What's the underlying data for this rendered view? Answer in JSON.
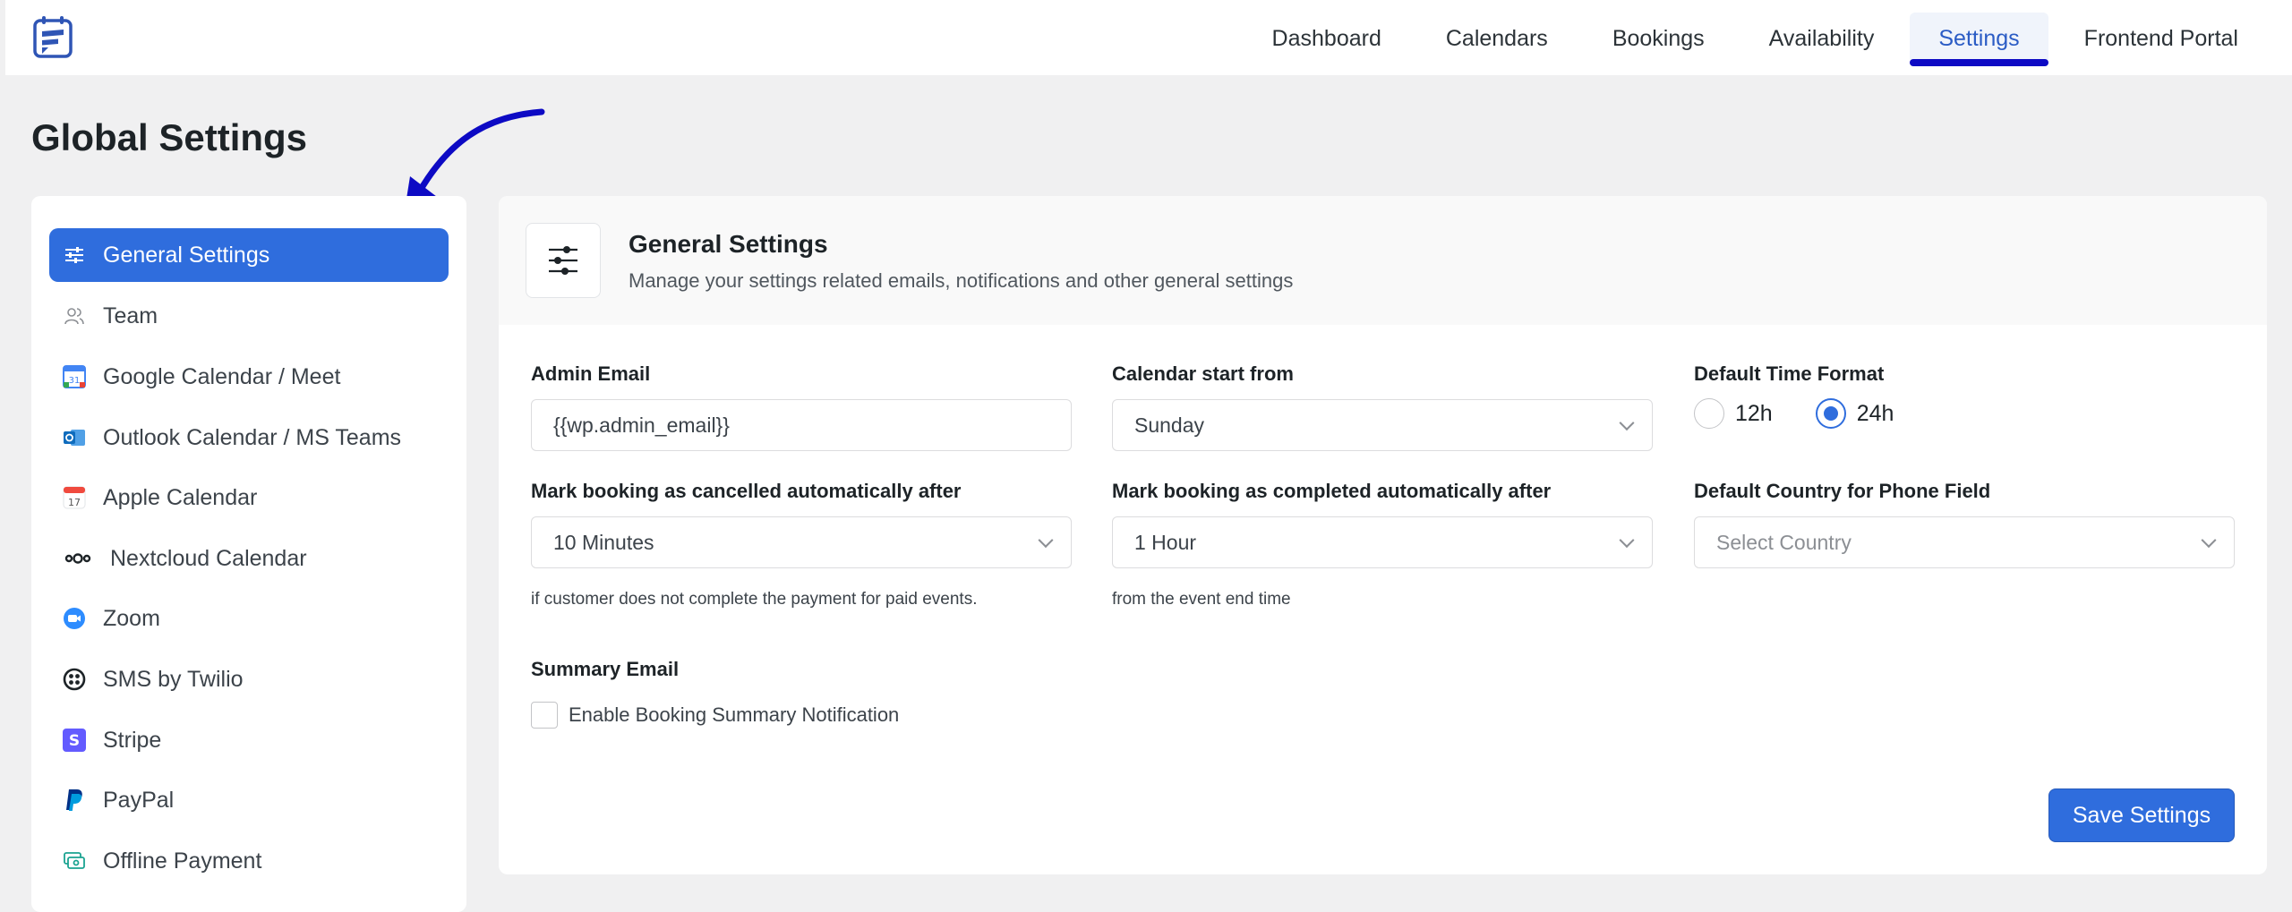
{
  "nav": {
    "items": [
      {
        "label": "Dashboard"
      },
      {
        "label": "Calendars"
      },
      {
        "label": "Bookings"
      },
      {
        "label": "Availability"
      },
      {
        "label": "Settings",
        "active": true
      },
      {
        "label": "Frontend Portal"
      }
    ]
  },
  "page": {
    "title": "Global Settings"
  },
  "sidebar": {
    "items": [
      {
        "label": "General Settings",
        "icon": "sliders-icon",
        "active": true
      },
      {
        "label": "Team",
        "icon": "team-icon"
      },
      {
        "label": "Google Calendar / Meet",
        "icon": "google-calendar-icon"
      },
      {
        "label": "Outlook Calendar / MS Teams",
        "icon": "outlook-icon"
      },
      {
        "label": "Apple Calendar",
        "icon": "apple-calendar-icon"
      },
      {
        "label": "Nextcloud Calendar",
        "icon": "nextcloud-icon"
      },
      {
        "label": "Zoom",
        "icon": "zoom-icon"
      },
      {
        "label": "SMS by Twilio",
        "icon": "twilio-icon"
      },
      {
        "label": "Stripe",
        "icon": "stripe-icon"
      },
      {
        "label": "PayPal",
        "icon": "paypal-icon"
      },
      {
        "label": "Offline Payment",
        "icon": "offline-payment-icon"
      }
    ]
  },
  "panel": {
    "title": "General Settings",
    "subtitle": "Manage your settings related emails, notifications and other general settings",
    "admin_email": {
      "label": "Admin Email",
      "value": "{{wp.admin_email}}"
    },
    "calendar_start": {
      "label": "Calendar start from",
      "value": "Sunday"
    },
    "time_format": {
      "label": "Default Time Format",
      "options": [
        "12h",
        "24h"
      ],
      "selected": "24h"
    },
    "cancel_after": {
      "label": "Mark booking as cancelled automatically after",
      "value": "10 Minutes",
      "hint": "if customer does not complete the payment for paid events."
    },
    "complete_after": {
      "label": "Mark booking as completed automatically after",
      "value": "1 Hour",
      "hint": "from the event end time"
    },
    "phone_country": {
      "label": "Default Country for Phone Field",
      "placeholder": "Select Country"
    },
    "summary_email": {
      "label": "Summary Email",
      "checkbox_label": "Enable Booking Summary Notification"
    },
    "save_label": "Save Settings"
  },
  "colors": {
    "accent": "#2f6ddd",
    "nav_underline": "#0d0ac4",
    "arrow": "#0d0ac4"
  }
}
